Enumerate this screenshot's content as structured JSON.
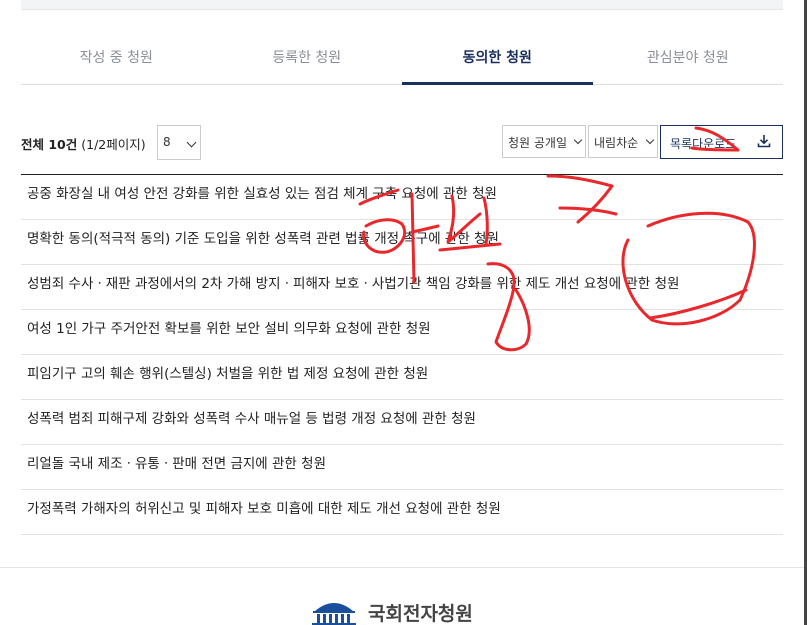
{
  "tabs": [
    {
      "label": "작성 중 청원",
      "active": false
    },
    {
      "label": "등록한 청원",
      "active": false
    },
    {
      "label": "동의한 청원",
      "active": true
    },
    {
      "label": "관심분야 청원",
      "active": false
    }
  ],
  "summary": {
    "total_label": "전체 10건",
    "page_info": "(1/2페이지)"
  },
  "page_size_select": {
    "value": "8"
  },
  "sort": {
    "field": "청원 공개일",
    "order": "내림차순"
  },
  "download_button": {
    "label": "목록다운로드",
    "icon": "download-icon"
  },
  "petitions": [
    "공중 화장실 내 여성 안전 강화를 위한 실효성 있는 점검 체계 구축 요청에 관한 청원",
    "명확한 동의(적극적 동의) 기준 도입을 위한 성폭력 관련 법률 개정 촉구에 관한 청원",
    "성범죄 수사ㆍ재판 과정에서의 2차 가해 방지ㆍ피해자 보호ㆍ사법기관 책임 강화를 위한 제도 개선 요청에 관한 청원",
    "여성 1인 가구 주거안전 확보를 위한 보안 설비 의무화 요청에 관한 청원",
    "피임기구 고의 훼손 행위(스텔싱) 처벌을 위한 법 제정 요청에 관한 청원",
    "성폭력 범죄 피해구제 강화와 성폭력 수사 매뉴얼 등 법령 개정 요청에 관한 청원",
    "리얼돌 국내 제조ㆍ유통ㆍ판매 전면 금지에 관한 청원",
    "가정폭력 가해자의 허위신고 및 피해자 보호 미흡에 대한 제도 개선 요청에 관한 청원"
  ],
  "footer": {
    "logo_text": "국회전자청원",
    "logo_icon": "national-assembly-icon"
  },
  "colors": {
    "accent": "#1a2f5e",
    "tab_inactive": "#8a8f96",
    "annotation": "#e8282b"
  }
}
